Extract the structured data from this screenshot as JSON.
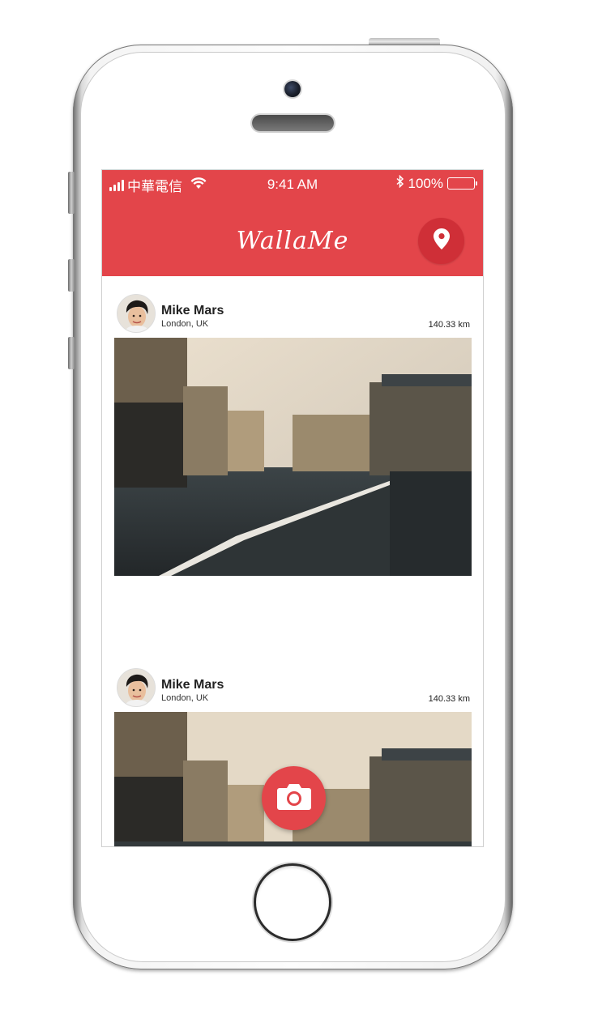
{
  "status_bar": {
    "carrier": "中華電信",
    "time": "9:41 AM",
    "battery": "100%",
    "battery_level": 1.0,
    "icons": [
      "signal-icon",
      "wifi-icon",
      "bluetooth-icon",
      "battery-icon"
    ]
  },
  "app_bar": {
    "title": "WallaMe",
    "map_icon": "location-pin-icon"
  },
  "feed": {
    "posts": [
      {
        "author": "Mike Mars",
        "location": "London, UK",
        "distance": "140.33 km",
        "image": "paris-street-crosswalk"
      },
      {
        "author": "Mike Mars",
        "location": "London, UK",
        "distance": "140.33 km",
        "image": "paris-street-crosswalk"
      }
    ]
  },
  "fab": {
    "icon": "camera-icon"
  },
  "colors": {
    "accent": "#e3454a",
    "accent_dark": "#cf2f37",
    "background": "#ffffff",
    "text": "#222222"
  }
}
